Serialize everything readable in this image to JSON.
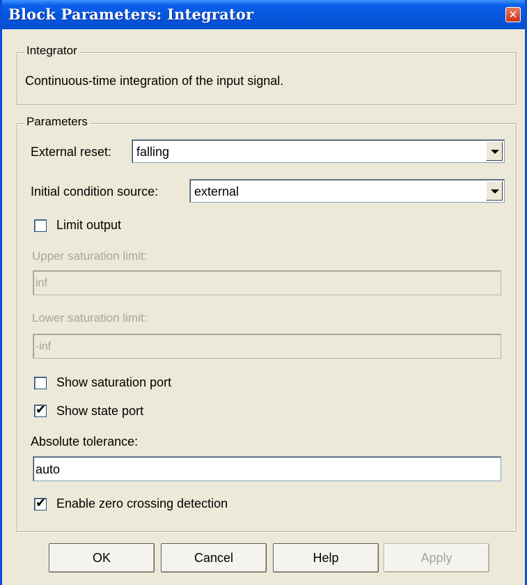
{
  "window": {
    "title": "Block Parameters: Integrator",
    "close_glyph": "✕"
  },
  "integrator_group": {
    "legend": "Integrator",
    "description": "Continuous-time integration of the input signal."
  },
  "parameters_group": {
    "legend": "Parameters",
    "external_reset": {
      "label": "External reset:",
      "value": "falling"
    },
    "initial_condition_source": {
      "label": "Initial condition source:",
      "value": "external"
    },
    "limit_output": {
      "label": "Limit output",
      "checked": false
    },
    "upper_saturation_limit": {
      "label": "Upper saturation limit:",
      "value": "inf",
      "enabled": false
    },
    "lower_saturation_limit": {
      "label": "Lower saturation limit:",
      "value": "-inf",
      "enabled": false
    },
    "show_saturation_port": {
      "label": "Show saturation port",
      "checked": false
    },
    "show_state_port": {
      "label": "Show state port",
      "checked": true,
      "mark": "✔"
    },
    "absolute_tolerance": {
      "label": "Absolute tolerance:",
      "value": "auto"
    },
    "zero_crossing": {
      "label": "Enable zero crossing detection",
      "checked": true,
      "mark": "✔"
    }
  },
  "buttons": {
    "ok": "OK",
    "cancel": "Cancel",
    "help": "Help",
    "apply": "Apply"
  },
  "colors": {
    "titlebar": "#0654dc",
    "window_bg": "#ece9d8",
    "disabled_text": "#a8a59a"
  }
}
